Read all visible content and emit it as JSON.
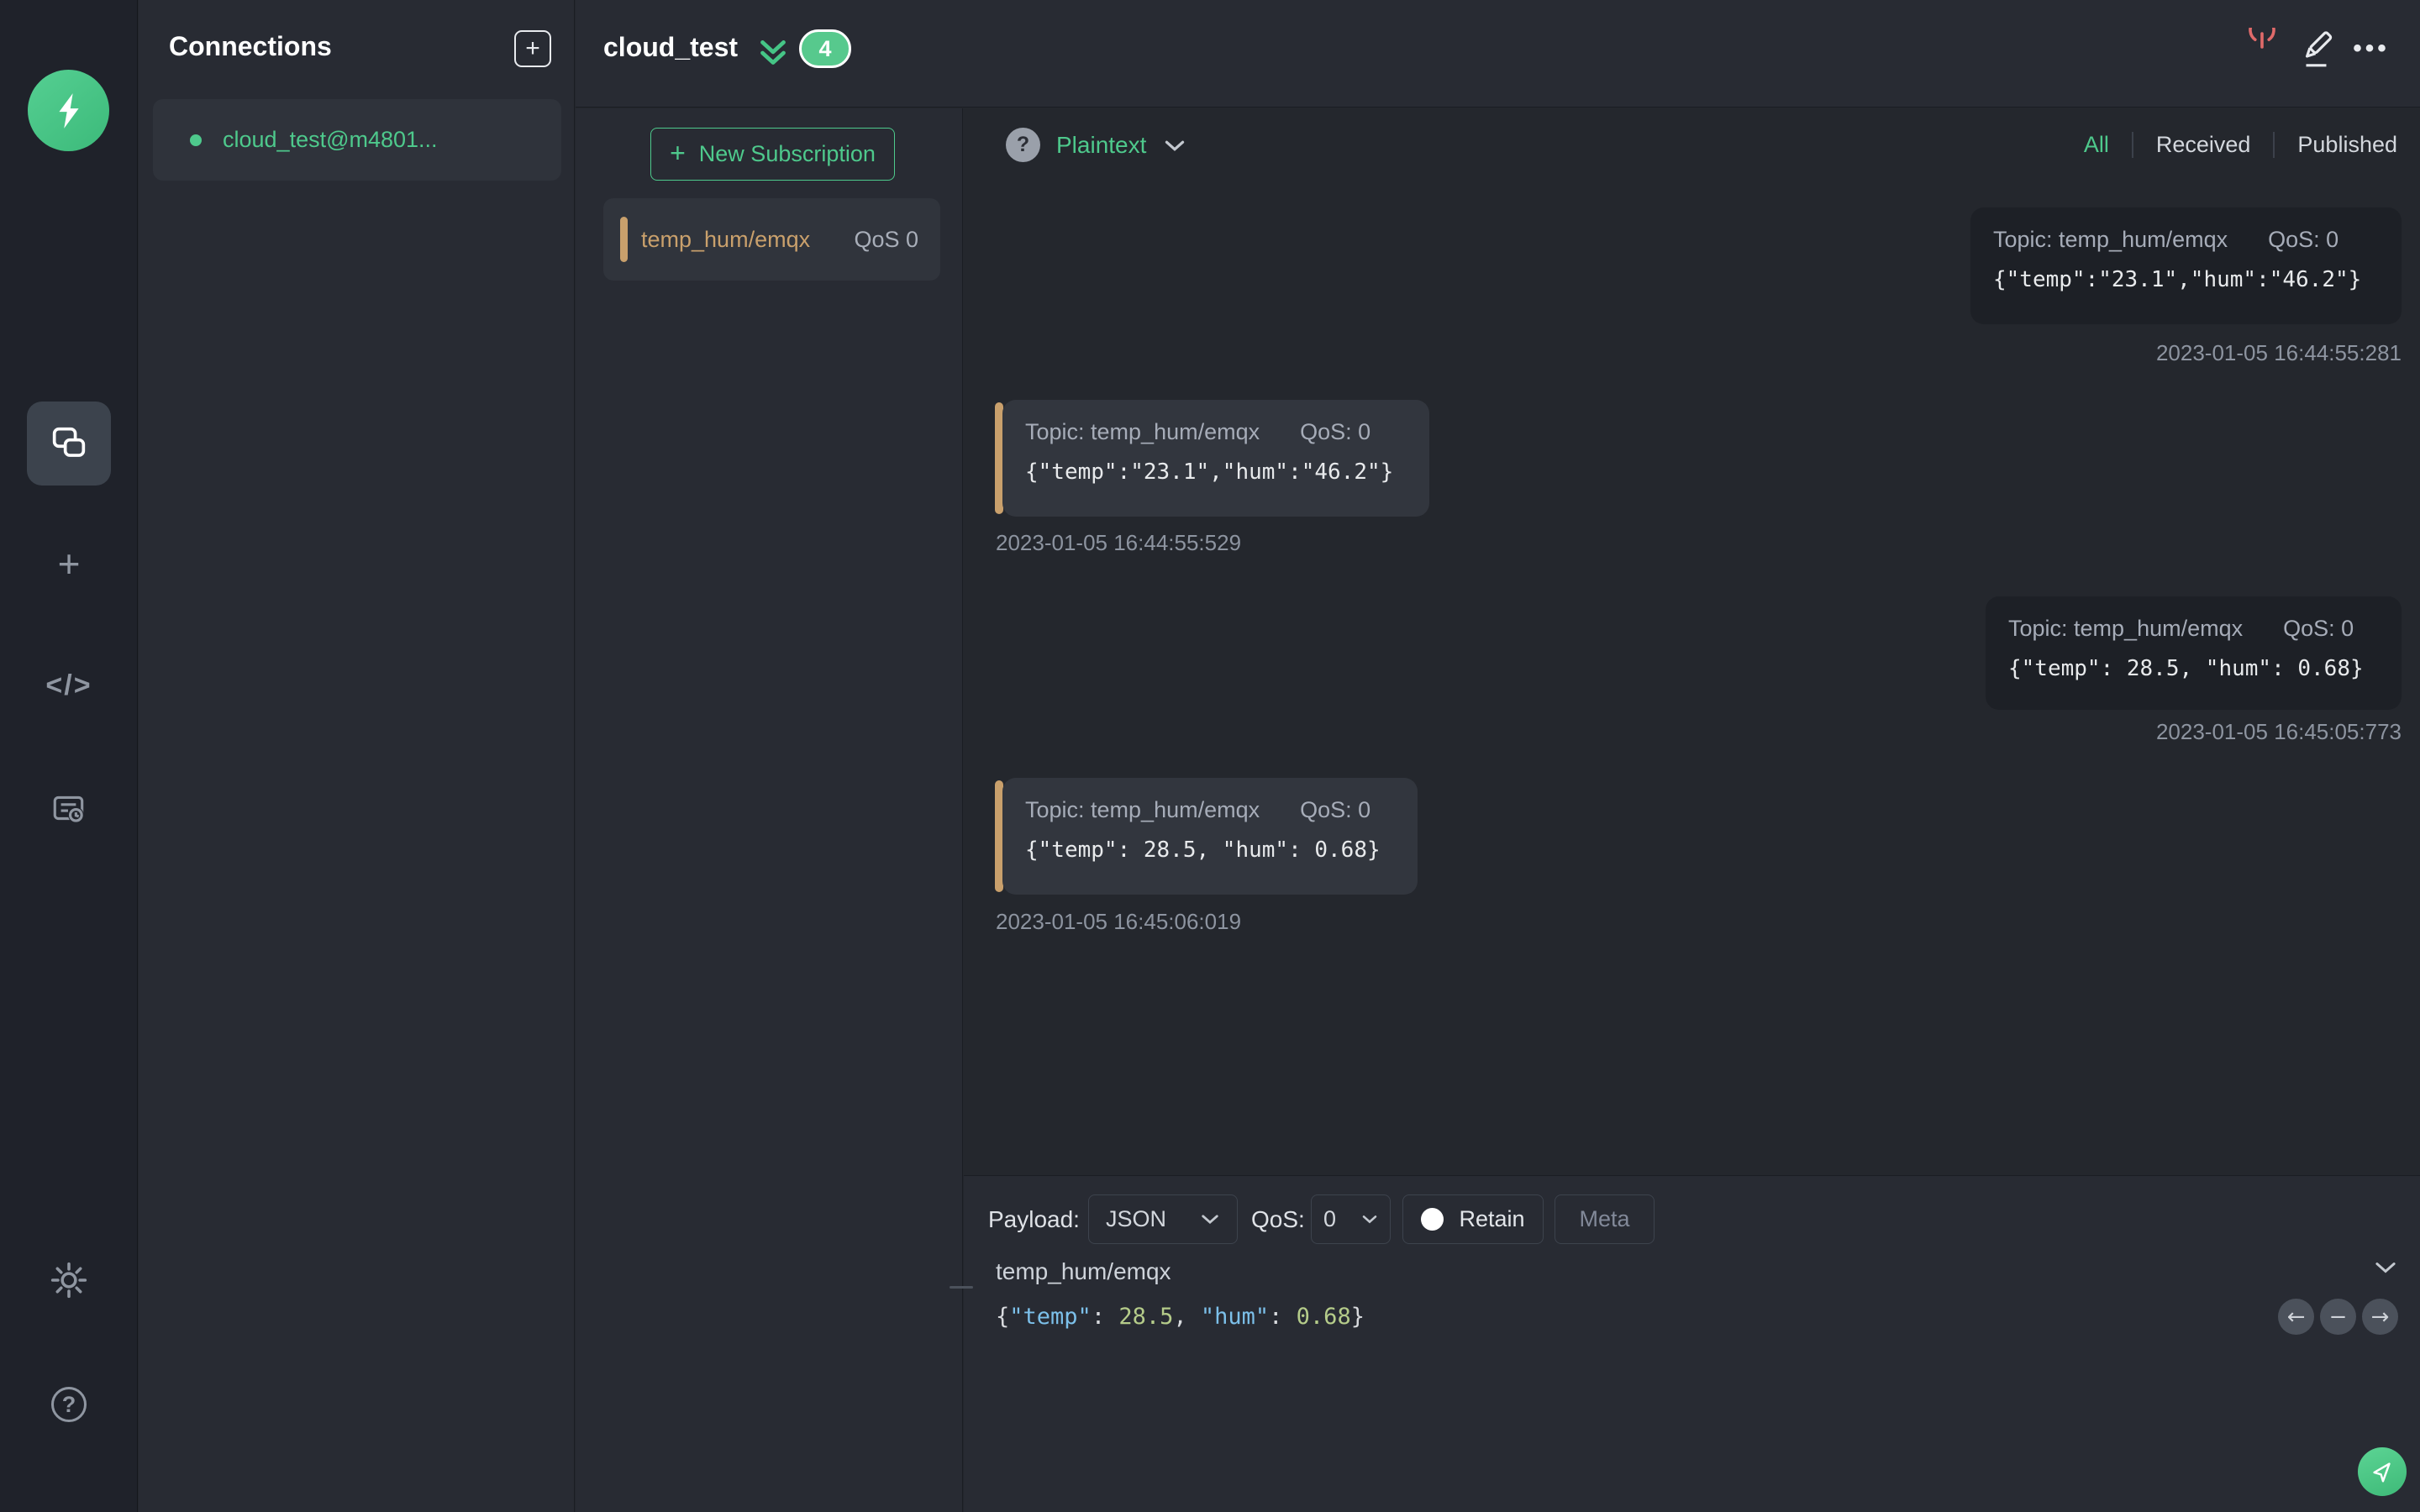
{
  "connections_panel": {
    "title": "Connections",
    "items": [
      {
        "label": "cloud_test@m4801...",
        "status": "connected"
      }
    ]
  },
  "header": {
    "title": "cloud_test",
    "badge_count": "4"
  },
  "subscriptions": {
    "new_button_label": "New Subscription",
    "items": [
      {
        "topic": "temp_hum/emqx",
        "qos": "QoS 0"
      }
    ]
  },
  "messages": {
    "format": "Plaintext",
    "filters": {
      "all": "All",
      "received": "Received",
      "published": "Published"
    },
    "active_filter": "All",
    "items": [
      {
        "direction": "published",
        "topic": "Topic: temp_hum/emqx",
        "qos": "QoS: 0",
        "payload": "{\"temp\":\"23.1\",\"hum\":\"46.2\"}",
        "time": "2023-01-05 16:44:55:281"
      },
      {
        "direction": "received",
        "topic": "Topic: temp_hum/emqx",
        "qos": "QoS: 0",
        "payload": "{\"temp\":\"23.1\",\"hum\":\"46.2\"}",
        "time": "2023-01-05 16:44:55:529"
      },
      {
        "direction": "published",
        "topic": "Topic: temp_hum/emqx",
        "qos": "QoS: 0",
        "payload": "{\"temp\": 28.5, \"hum\": 0.68}",
        "time": "2023-01-05 16:45:05:773"
      },
      {
        "direction": "received",
        "topic": "Topic: temp_hum/emqx",
        "qos": "QoS: 0",
        "payload": "{\"temp\": 28.5, \"hum\": 0.68}",
        "time": "2023-01-05 16:45:06:019"
      }
    ]
  },
  "publish": {
    "payload_label": "Payload:",
    "payload_format": "JSON",
    "qos_label": "QoS:",
    "qos_value": "0",
    "retain_label": "Retain",
    "meta_label": "Meta",
    "topic_value": "temp_hum/emqx",
    "payload_tokens": [
      {
        "text": "{",
        "type": "punct"
      },
      {
        "text": "\"temp\"",
        "type": "key"
      },
      {
        "text": ": ",
        "type": "punct"
      },
      {
        "text": "28.5",
        "type": "number"
      },
      {
        "text": ", ",
        "type": "punct"
      },
      {
        "text": "\"hum\"",
        "type": "key"
      },
      {
        "text": ": ",
        "type": "punct"
      },
      {
        "text": "0.68",
        "type": "number"
      },
      {
        "text": "}",
        "type": "punct"
      }
    ]
  },
  "colors": {
    "accent_green": "#4ec98c",
    "topic_orange": "#c9a06c",
    "power_red": "#e06a6a",
    "json_key_blue": "#7cc0ea",
    "json_number_green": "#b5cc8a"
  }
}
